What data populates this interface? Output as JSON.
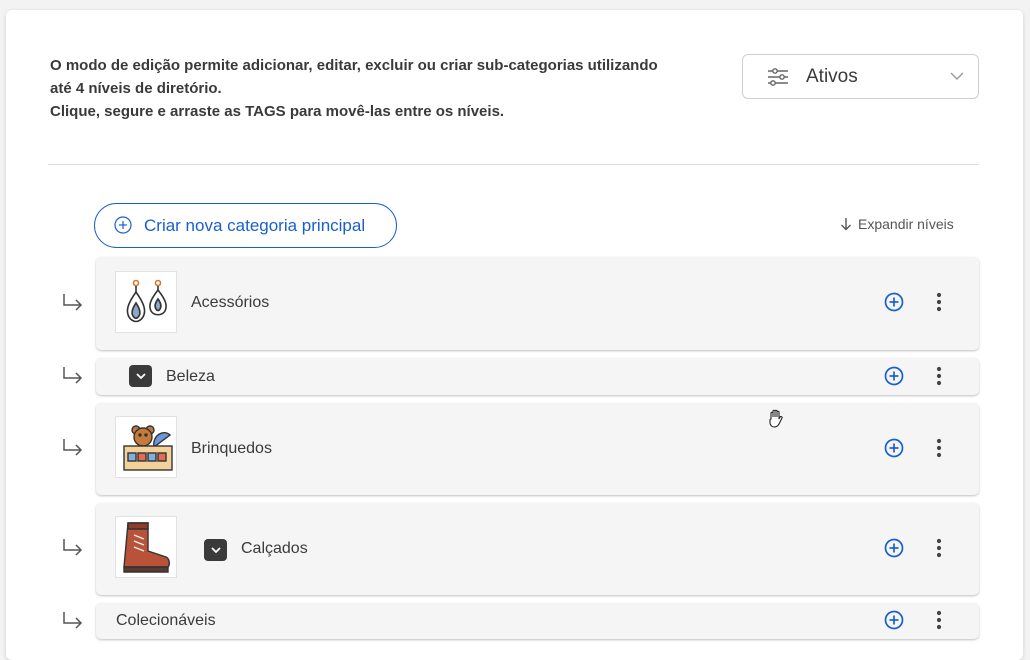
{
  "intro": {
    "line1": "O modo de edição permite adicionar, editar, excluir ou criar sub-categorias utilizando",
    "line2": "até 4 níveis de diretório.",
    "line3": "Clique, segure e arraste as TAGS para movê-las entre os níveis."
  },
  "status_filter": {
    "value": "Ativos",
    "icon": "sliders-icon"
  },
  "create_button": {
    "label": "Criar nova categoria principal"
  },
  "expand": {
    "label": "Expandir níveis"
  },
  "categories": [
    {
      "label": "Acessórios",
      "image": "earrings"
    },
    {
      "label": "Beleza",
      "has_children": true
    },
    {
      "label": "Brinquedos",
      "image": "toy-box"
    },
    {
      "label": "Calçados",
      "image": "boot",
      "has_children": true
    },
    {
      "label": "Colecionáveis"
    }
  ],
  "colors": {
    "accent": "#1a5fd0",
    "text": "#3a3a3a",
    "row_bg": "#f5f5f5"
  }
}
